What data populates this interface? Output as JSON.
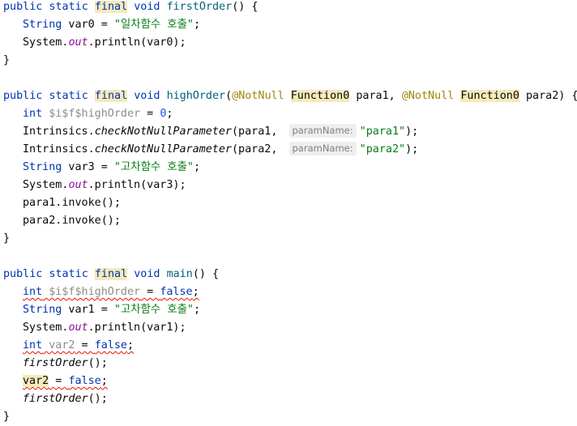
{
  "code": {
    "first_order": {
      "signature": {
        "mod1": "public",
        "mod2": "static",
        "mod3": "final",
        "ret": "void",
        "name": "firstOrder",
        "paren": "() {"
      },
      "l1": {
        "type": "String",
        "rest": " var0 = ",
        "str": "\"일차함수 호출\"",
        "end": ";"
      },
      "l2": {
        "obj": "System.",
        "field": "out",
        "call": ".println(var0);"
      },
      "close": "}"
    },
    "high_order": {
      "signature": {
        "mod1": "public",
        "mod2": "static",
        "mod3": "final",
        "ret": "void",
        "name": "highOrder",
        "open": "(",
        "ann1": "@NotNull",
        "type1": "Function0",
        "p1": " para1, ",
        "ann2": "@NotNull",
        "type2": "Function0",
        "p2": " para2) {"
      },
      "l1": {
        "type": "int",
        "name": " $i$f$highOrder",
        "eq": " = ",
        "num": "0",
        "end": ";"
      },
      "l2": {
        "obj": "Intrinsics.",
        "method": "checkNotNullParameter",
        "args": "(para1, ",
        "hint": "paramName:",
        "str": "\"para1\"",
        "end": ");"
      },
      "l3": {
        "obj": "Intrinsics.",
        "method": "checkNotNullParameter",
        "args": "(para2, ",
        "hint": "paramName:",
        "str": "\"para2\"",
        "end": ");"
      },
      "l4": {
        "type": "String",
        "rest": " var3 = ",
        "str": "\"고차함수 호출\"",
        "end": ";"
      },
      "l5": {
        "obj": "System.",
        "field": "out",
        "call": ".println(var3);"
      },
      "l6": "para1.invoke();",
      "l7": "para2.invoke();",
      "close": "}"
    },
    "main": {
      "signature": {
        "mod1": "public",
        "mod2": "static",
        "mod3": "final",
        "ret": "void",
        "name": "main",
        "paren": "() {"
      },
      "l1": {
        "type": "int",
        "name": " $i$f$highOrder",
        "eq": " = ",
        "val": "false",
        "end": ";"
      },
      "l2": {
        "type": "String",
        "rest": " var1 = ",
        "str": "\"고차함수 호출\"",
        "end": ";"
      },
      "l3": {
        "obj": "System.",
        "field": "out",
        "call": ".println(var1);"
      },
      "l4": {
        "type": "int",
        "name": " var2",
        "eq": " = ",
        "val": "false",
        "end": ";"
      },
      "l5": {
        "call": "firstOrder",
        "end": "();"
      },
      "l6": {
        "var": "var2",
        "eq": " = ",
        "val": "false",
        "end": ";"
      },
      "l7": {
        "call": "firstOrder",
        "end": "();"
      },
      "close": "}"
    }
  }
}
